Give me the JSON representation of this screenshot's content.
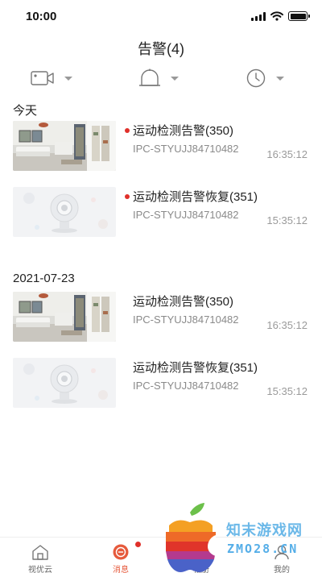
{
  "status_bar": {
    "time": "10:00"
  },
  "header": {
    "title": "告警(4)"
  },
  "filters": [
    {
      "icon": "camera-icon"
    },
    {
      "icon": "bell-icon"
    },
    {
      "icon": "clock-icon"
    }
  ],
  "sections": [
    {
      "date": "今天",
      "items": [
        {
          "thumbnail": "room-photo",
          "unread": true,
          "title": "运动检测告警(350)",
          "device": "IPC-STYUJJ84710482",
          "time": "16:35:12"
        },
        {
          "thumbnail": "camera-placeholder",
          "unread": true,
          "title": "运动检测告警恢复(351)",
          "device": "IPC-STYUJJ84710482",
          "time": "15:35:12"
        }
      ]
    },
    {
      "date": "2021-07-23",
      "items": [
        {
          "thumbnail": "room-photo",
          "unread": false,
          "title": "运动检测告警(350)",
          "device": "IPC-STYUJJ84710482",
          "time": "16:35:12"
        },
        {
          "thumbnail": "camera-placeholder",
          "unread": false,
          "title": "运动检测告警恢复(351)",
          "device": "IPC-STYUJJ84710482",
          "time": "15:35:12"
        }
      ]
    }
  ],
  "tab_bar": {
    "tabs": [
      {
        "label": "视优云",
        "icon": "home-icon",
        "active": false
      },
      {
        "label": "消息",
        "icon": "message-icon",
        "active": true,
        "badge": true
      },
      {
        "label": "相册",
        "icon": "album-icon",
        "active": false
      },
      {
        "label": "我的",
        "icon": "profile-icon",
        "active": false
      }
    ]
  },
  "watermark": {
    "text": "知末游戏网",
    "url": "ZMO28.CN"
  },
  "colors": {
    "accent": "#e65a3c",
    "unread_dot": "#e0302a",
    "watermark": "#6bb8e8"
  }
}
